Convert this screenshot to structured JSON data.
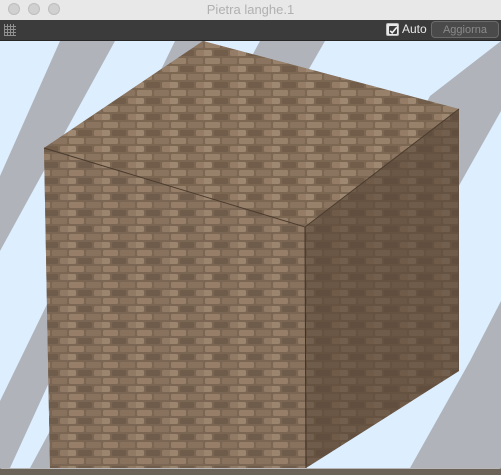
{
  "window": {
    "title": "Pietra langhe.1"
  },
  "toolbar": {
    "grip_icon": "grid-grip-icon",
    "auto_checked": true,
    "auto_label": "Auto",
    "update_label": "Aggiorna"
  },
  "preview": {
    "background_color": "#ddeeff",
    "stripe_color": "#b0b4ba",
    "object": "cube",
    "material": "stone brick texture"
  }
}
